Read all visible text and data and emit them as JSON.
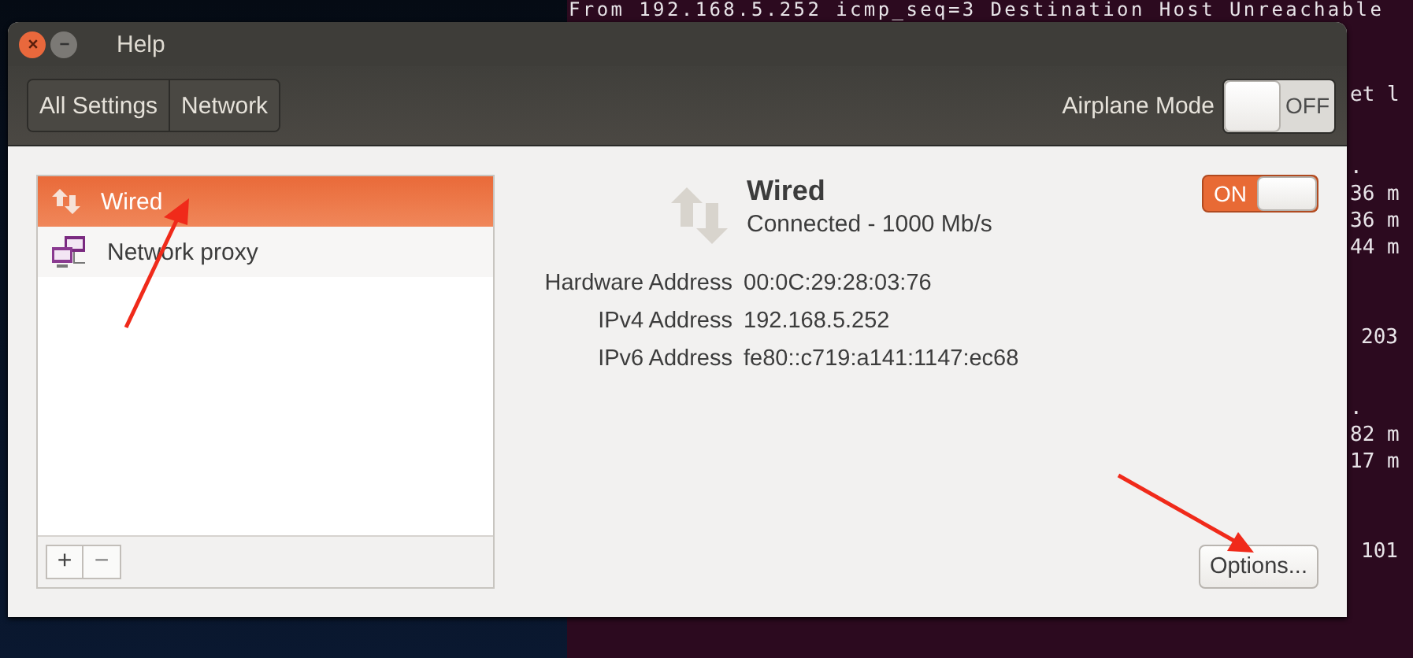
{
  "terminal": {
    "top_line": "From 192.168.5.252 icmp_seq=3 Destination Host Unreachable",
    "right_blocks": [
      [
        "et l"
      ],
      [
        ".",
        "36 m",
        "36 m",
        "44 m"
      ],
      [
        "203"
      ],
      [
        ".",
        "82 m",
        "17 m"
      ],
      [
        "101"
      ]
    ]
  },
  "window": {
    "title": "Help"
  },
  "breadcrumbs": [
    {
      "label": "All Settings"
    },
    {
      "label": "Network"
    }
  ],
  "airplane_mode": {
    "label": "Airplane Mode",
    "switch_text": "OFF",
    "on": false
  },
  "devices": [
    {
      "name": "Wired",
      "kind": "wired",
      "selected": true
    },
    {
      "name": "Network proxy",
      "kind": "proxy",
      "selected": false
    }
  ],
  "list_buttons": [
    "+",
    "−"
  ],
  "detail": {
    "name": "Wired",
    "status": "Connected - 1000 Mb/s",
    "switch_text": "ON",
    "on": true,
    "rows": [
      {
        "label": "Hardware Address",
        "value": "00:0C:29:28:03:76"
      },
      {
        "label": "IPv4 Address",
        "value": "192.168.5.252"
      },
      {
        "label": "IPv6 Address",
        "value": "fe80::c719:a141:1147:ec68"
      }
    ]
  },
  "options_button": "Options..."
}
